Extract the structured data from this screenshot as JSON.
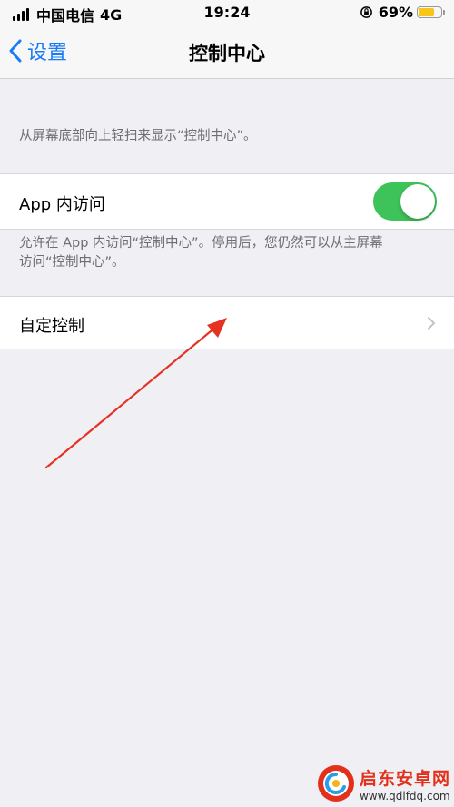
{
  "status_bar": {
    "carrier": "中国电信",
    "network": "4G",
    "time": "19:24",
    "battery_percent": "69%",
    "battery_level": 0.69,
    "battery_color": "#f8c51a"
  },
  "nav": {
    "back_label": "设置",
    "title": "控制中心",
    "accent_color": "#1a7cf5"
  },
  "intro_note": "从屏幕底部向上轻扫来显示“控制中心”。",
  "access_within_apps": {
    "label": "App 内访问",
    "enabled": true,
    "toggle_color": "#3ec25a",
    "note_line1": "允许在 App 内访问“控制中心”。停用后，您仍然可以从主屏幕",
    "note_line2": "访问“控制中心”。"
  },
  "customize_controls": {
    "label": "自定控制",
    "icon": "chevron-right-icon"
  },
  "watermark": {
    "title": "启东安卓网",
    "url": "www.qdlfdq.com"
  }
}
